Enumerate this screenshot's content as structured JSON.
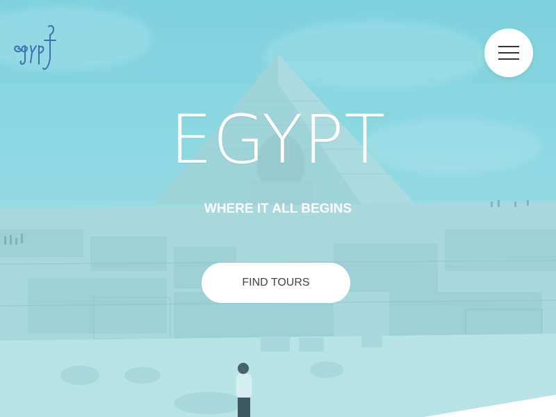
{
  "header": {
    "logo_text": "egypt",
    "menu_icon": "hamburger-menu-icon"
  },
  "hero": {
    "title": "EGYPT",
    "subtitle": "WHERE IT ALL BEGINS",
    "cta_label": "FIND TOURS",
    "background_image": "pyramid-and-sphinx-photo"
  },
  "colors": {
    "tint": "#7fd3de",
    "text": "#ffffff",
    "button_bg": "#ffffff",
    "button_text": "#444444"
  }
}
